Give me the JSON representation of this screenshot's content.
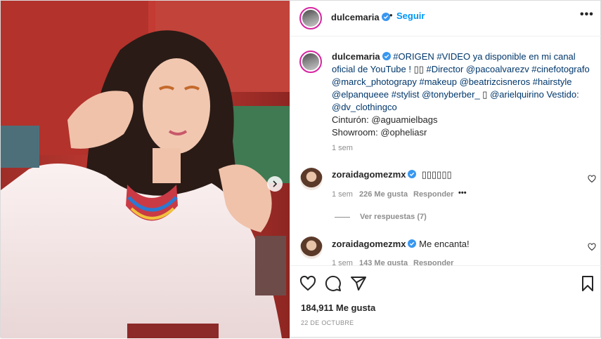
{
  "post": {
    "username": "dulcemaria",
    "follow_label": "Seguir",
    "separator": "•",
    "more_label": "•••"
  },
  "caption": {
    "username": "dulcemaria",
    "text_1": "#ORIGEN #VIDEO ya disponible en mi canal oficial de YouTube ! ",
    "text_2": "#Director @pacoalvarezv #cinefotografo @marck_photograpy #makeup @beatrizcisneros #hairstyle @elpanqueee #stylist @tonyberber_ ",
    "text_3": " @arielquirino Vestido: @dv_clothingco",
    "line_cinturon": "Cinturón: @aguamielbags",
    "line_showroom": "Showroom: @opheliasr",
    "time": "1 sem"
  },
  "comments": [
    {
      "username": "zoraidagomezmx",
      "text": "",
      "time": "1 sem",
      "likes": "226 Me gusta",
      "reply_label": "Responder",
      "options_label": "•••"
    },
    {
      "username": "zoraidagomezmx",
      "text": "Me encanta!",
      "time": "1 sem",
      "likes": "143 Me gusta",
      "reply_label": "Responder"
    }
  ],
  "view_replies_label": "Ver respuestas (7)",
  "footer": {
    "likes": "184,911 Me gusta",
    "date": "22 DE OCTUBRE"
  },
  "icons": {
    "like": "heart-icon",
    "comment": "comment-icon",
    "share": "share-icon",
    "save": "bookmark-icon",
    "verified": "verified-badge-icon",
    "next": "chevron-right-icon"
  },
  "colors": {
    "link": "#00376b",
    "follow": "#0095f6",
    "verified": "#3897f0"
  }
}
